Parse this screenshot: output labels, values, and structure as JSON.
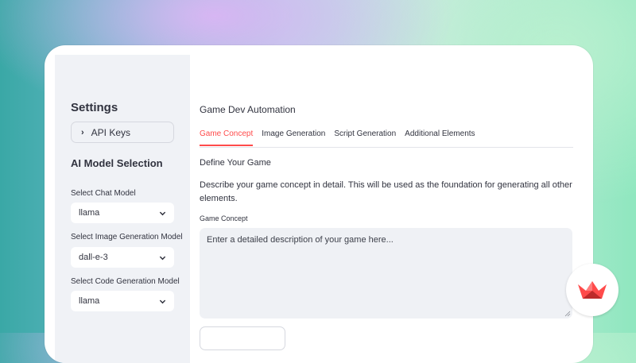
{
  "sidebar": {
    "settings_title": "Settings",
    "api_keys_label": "API Keys",
    "model_section_title": "AI Model Selection",
    "chat_model": {
      "label": "Select Chat Model",
      "value": "llama"
    },
    "image_model": {
      "label": "Select Image Generation Model",
      "value": "dall-e-3"
    },
    "code_model": {
      "label": "Select Code Generation Model",
      "value": "llama"
    }
  },
  "main": {
    "title": "Game Dev Automation",
    "tabs": [
      {
        "label": "Game Concept",
        "active": true
      },
      {
        "label": "Image Generation",
        "active": false
      },
      {
        "label": "Script Generation",
        "active": false
      },
      {
        "label": "Additional Elements",
        "active": false
      }
    ],
    "section_title": "Define Your Game",
    "description": "Describe your game concept in detail. This will be used as the foundation for generating all other elements.",
    "textarea": {
      "label": "Game Concept",
      "value": "",
      "placeholder": "Enter a detailed description of your game here..."
    }
  },
  "colors": {
    "accent": "#ff4b4b",
    "sidebar_bg": "#f0f2f6",
    "text": "#31333f"
  },
  "icons": {
    "expander": "chevron-right-icon",
    "select": "chevron-down-icon",
    "logo": "streamlit-crown-logo"
  }
}
